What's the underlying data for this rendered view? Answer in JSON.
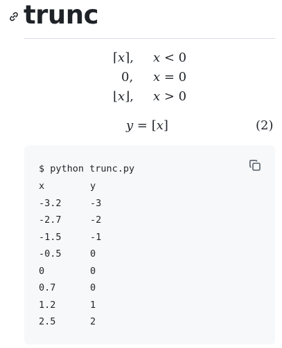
{
  "heading": {
    "title": "trunc",
    "anchor_icon": "link-icon"
  },
  "formula": {
    "cases": [
      {
        "value_left": "⌈",
        "value_var": "x",
        "value_right": "⌉,",
        "cond_var": "x",
        "cond_rest": " < 0"
      },
      {
        "value_left": "0,",
        "value_var": "",
        "value_right": "",
        "cond_var": "x",
        "cond_rest": " = 0"
      },
      {
        "value_left": "⌊",
        "value_var": "x",
        "value_right": "⌋,",
        "cond_var": "x",
        "cond_rest": " > 0"
      }
    ],
    "equation": {
      "lhs_var": "y",
      "op": " = ",
      "rhs_left": "[",
      "rhs_var": "x",
      "rhs_right": "]"
    },
    "equation_number": "(2)"
  },
  "code": {
    "copy_icon": "copy-icon",
    "command": "$ python trunc.py",
    "header": {
      "x": "x",
      "y": "y"
    },
    "rows": [
      {
        "x": "-3.2",
        "y": "-3"
      },
      {
        "x": "-2.7",
        "y": "-2"
      },
      {
        "x": "-1.5",
        "y": "-1"
      },
      {
        "x": "-0.5",
        "y": "0"
      },
      {
        "x": "0",
        "y": "0"
      },
      {
        "x": "0.7",
        "y": "0"
      },
      {
        "x": "1.2",
        "y": "1"
      },
      {
        "x": "2.5",
        "y": "2"
      }
    ]
  }
}
